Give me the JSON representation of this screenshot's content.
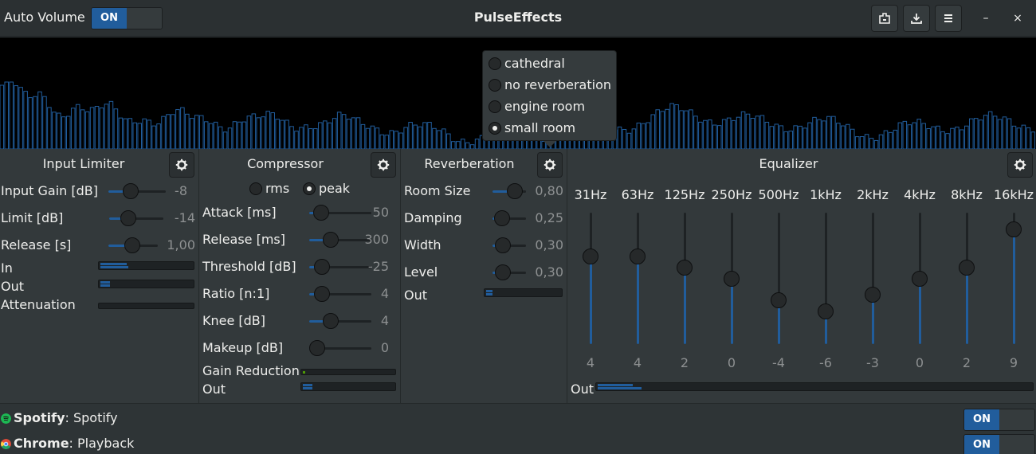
{
  "header": {
    "auto_volume_label": "Auto Volume",
    "auto_volume_switch": "ON",
    "title": "PulseEffects",
    "buttons": [
      "save-preset-icon",
      "load-preset-icon",
      "menu-icon"
    ],
    "minimize": "–",
    "close": "×"
  },
  "colors": {
    "accent": "#215d9c",
    "background": "#33393b",
    "spectrum_bg": "#000000"
  },
  "input_limiter": {
    "title": "Input Limiter",
    "input_gain": {
      "label": "Input Gain [dB]",
      "value": "-8",
      "fraction": 0.35
    },
    "limit": {
      "label": "Limit [dB]",
      "value": "-14",
      "fraction": 0.3
    },
    "release": {
      "label": "Release [s]",
      "value": "1,00",
      "fraction": 0.47
    },
    "in_label": "In",
    "out_label": "Out",
    "attenuation_label": "Attenuation",
    "levels": {
      "in": [
        0.28,
        0.3
      ],
      "out": [
        0.1,
        0.1
      ],
      "attenuation": [
        0,
        0
      ]
    }
  },
  "compressor": {
    "title": "Compressor",
    "modes": [
      {
        "label": "rms",
        "checked": false
      },
      {
        "label": "peak",
        "checked": true
      }
    ],
    "controls": [
      {
        "label": "Attack [ms]",
        "value": "50",
        "fraction": 0.08
      },
      {
        "label": "Release [ms]",
        "value": "300",
        "fraction": 0.3
      },
      {
        "label": "Threshold [dB]",
        "value": "-25",
        "fraction": 0.1
      },
      {
        "label": "Ratio [n:1]",
        "value": "4",
        "fraction": 0.1
      },
      {
        "label": "Knee [dB]",
        "value": "4",
        "fraction": 0.29
      },
      {
        "label": "Makeup [dB]",
        "value": "0",
        "fraction": 0
      }
    ],
    "gain_reduction_label": "Gain Reduction",
    "out_label": "Out",
    "levels": {
      "gain_reduction": 0.03,
      "out": [
        0.1,
        0.1
      ]
    }
  },
  "reverberation": {
    "title": "Reverberation",
    "controls": [
      {
        "label": "Room Size",
        "value": "0,80",
        "fraction": 0.8
      },
      {
        "label": "Damping",
        "value": "0,25",
        "fraction": 0.1
      },
      {
        "label": "Width",
        "value": "0,30",
        "fraction": 0.12
      },
      {
        "label": "Level",
        "value": "0,30",
        "fraction": 0.12
      }
    ],
    "out_label": "Out",
    "levels": {
      "out": [
        0.08,
        0.08
      ]
    },
    "presets": [
      {
        "label": "cathedral",
        "checked": false
      },
      {
        "label": "no reverberation",
        "checked": false
      },
      {
        "label": "engine room",
        "checked": false
      },
      {
        "label": "small room",
        "checked": true
      }
    ]
  },
  "equalizer": {
    "title": "Equalizer",
    "bands": [
      {
        "freq": "31Hz",
        "value": "4"
      },
      {
        "freq": "63Hz",
        "value": "4"
      },
      {
        "freq": "125Hz",
        "value": "2"
      },
      {
        "freq": "250Hz",
        "value": "0"
      },
      {
        "freq": "500Hz",
        "value": "-4"
      },
      {
        "freq": "1kHz",
        "value": "-6"
      },
      {
        "freq": "2kHz",
        "value": "-3"
      },
      {
        "freq": "4kHz",
        "value": "0"
      },
      {
        "freq": "8kHz",
        "value": "2"
      },
      {
        "freq": "16kHz",
        "value": "9"
      }
    ],
    "out_label": "Out",
    "levels": {
      "out": [
        0.08,
        0.1
      ]
    }
  },
  "apps": [
    {
      "name": "Spotify",
      "stream": ": Spotify",
      "switch": "ON",
      "icon": "spotify-icon",
      "icon_color": "#1db954"
    },
    {
      "name": "Chrome",
      "stream": ": Playback",
      "switch": "ON",
      "icon": "chrome-icon",
      "icon_color": "#dd4b39"
    }
  ]
}
